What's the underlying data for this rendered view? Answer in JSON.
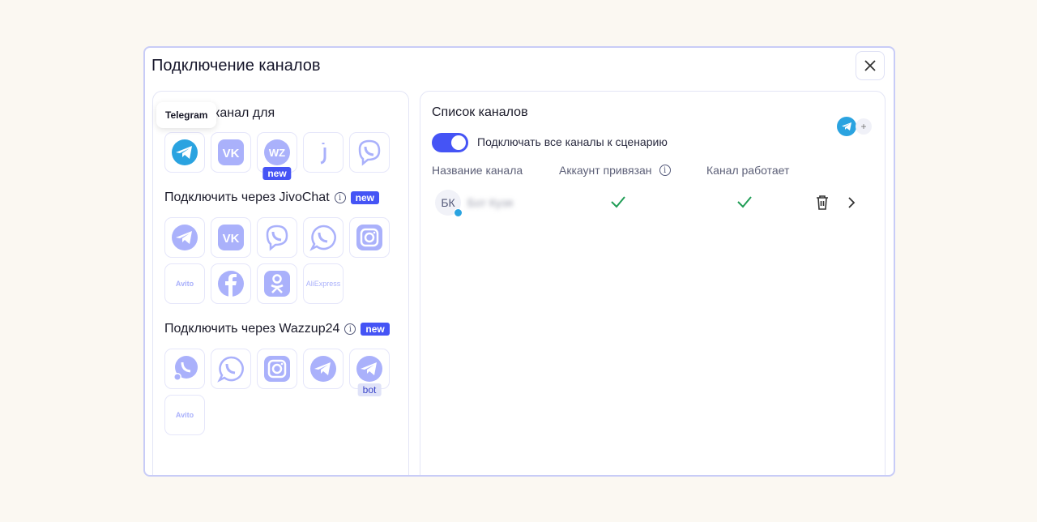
{
  "modal": {
    "title": "Подключение каналов",
    "close_icon": "close-icon"
  },
  "left": {
    "tooltip": "Telegram",
    "direct_heading": "канал для",
    "direct_channels": [
      {
        "name": "telegram",
        "icon": "telegram",
        "active": true
      },
      {
        "name": "vk",
        "icon": "vk"
      },
      {
        "name": "wazzup",
        "icon": "wz",
        "badge": "new"
      },
      {
        "name": "jivo",
        "icon": "j"
      },
      {
        "name": "viber",
        "icon": "viber"
      }
    ],
    "jivo_heading": "Подключить через JivoChat",
    "jivo_badge": "new",
    "jivo_channels": [
      {
        "name": "telegram",
        "icon": "telegram"
      },
      {
        "name": "vk",
        "icon": "vk"
      },
      {
        "name": "viber",
        "icon": "viber"
      },
      {
        "name": "whatsapp",
        "icon": "whatsapp"
      },
      {
        "name": "instagram",
        "icon": "instagram"
      },
      {
        "name": "avito",
        "icon": "avito",
        "label": "Avito"
      },
      {
        "name": "facebook",
        "icon": "facebook"
      },
      {
        "name": "odnoklassniki",
        "icon": "ok"
      },
      {
        "name": "aliexpress",
        "icon": "aliexpress",
        "label": "AliExpress"
      }
    ],
    "wazzup_heading": "Подключить через Wazzup24",
    "wazzup_badge": "new",
    "wazzup_channels": [
      {
        "name": "whatsapp-business",
        "icon": "wabiz"
      },
      {
        "name": "whatsapp",
        "icon": "whatsapp"
      },
      {
        "name": "instagram",
        "icon": "instagram"
      },
      {
        "name": "telegram",
        "icon": "telegram"
      },
      {
        "name": "telegram-bot",
        "icon": "telegram",
        "badge": "bot"
      },
      {
        "name": "avito",
        "icon": "avito",
        "label": "Avito"
      }
    ]
  },
  "right": {
    "heading": "Список каналов",
    "toggle_label": "Подключать все каналы к сценарию",
    "toggle_on": true,
    "add_label": "+",
    "columns": [
      "Название канала",
      "Аккаунт привязан",
      "Канал работает"
    ],
    "rows": [
      {
        "initials": "БК",
        "name": "Бот Кузя",
        "account_linked": true,
        "working": true
      }
    ]
  },
  "colors": {
    "accent": "#4554f5",
    "icon": "#aab1fb",
    "telegram": "#2aa3e0",
    "check": "#1f9d55"
  }
}
